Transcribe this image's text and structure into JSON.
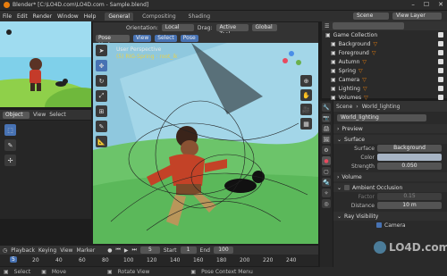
{
  "window": {
    "title": "Blender* [C:\\LO4D.com\\LO4D.com - Sample.blend]"
  },
  "menu": {
    "items": [
      "File",
      "Edit",
      "Render",
      "Window",
      "Help"
    ],
    "tabs": [
      "General",
      "Compositing",
      "Shading"
    ],
    "scene_label": "Scene",
    "view_layer_label": "View Layer"
  },
  "left": {
    "mode": "Object",
    "view": "View",
    "select": "Select"
  },
  "viewport": {
    "mode": "Pose Mode",
    "view": "View",
    "select": "Select",
    "pose": "Pose",
    "orientation_label": "Orientation:",
    "orientation_value": "Local",
    "drag_label": "Drag:",
    "drag_value": "Active Tool",
    "pivot": "Global",
    "info_line1": "User Perspective",
    "info_line2": "(5) RIG-Spring : root_ik"
  },
  "outliner": {
    "items": [
      {
        "label": "Game Collection"
      },
      {
        "label": "Background"
      },
      {
        "label": "Foreground"
      },
      {
        "label": "Autumn"
      },
      {
        "label": "Spring"
      },
      {
        "label": "Camera"
      },
      {
        "label": "Lighting"
      },
      {
        "label": "Volumes"
      }
    ]
  },
  "properties": {
    "scene": "Scene",
    "world": "World_lighting",
    "world_field": "World_lighting",
    "sections": {
      "preview": "Preview",
      "surface": "Surface",
      "volume": "Volume",
      "ao": "Ambient Occlusion",
      "ray": "Ray Visibility"
    },
    "surface_label": "Surface",
    "surface_value": "Background",
    "color_label": "Color",
    "strength_label": "Strength",
    "strength_value": "0.050",
    "factor_label": "Factor",
    "factor_value": "0.15",
    "distance_label": "Distance",
    "distance_value": "10 m",
    "camera_label": "Camera"
  },
  "timeline": {
    "playback": "Playback",
    "keying": "Keying",
    "view": "View",
    "marker": "Marker",
    "current": "5",
    "start_label": "Start",
    "start": "1",
    "end_label": "End",
    "end": "100",
    "ticks": [
      "0",
      "20",
      "40",
      "60",
      "80",
      "100",
      "120",
      "140",
      "160",
      "180",
      "200",
      "220",
      "240"
    ],
    "current_frame_marker": "5"
  },
  "status": {
    "select": "Select",
    "move": "Move",
    "rotate": "Rotate View",
    "context": "Pose Context Menu"
  },
  "watermark": "LO4D.com"
}
